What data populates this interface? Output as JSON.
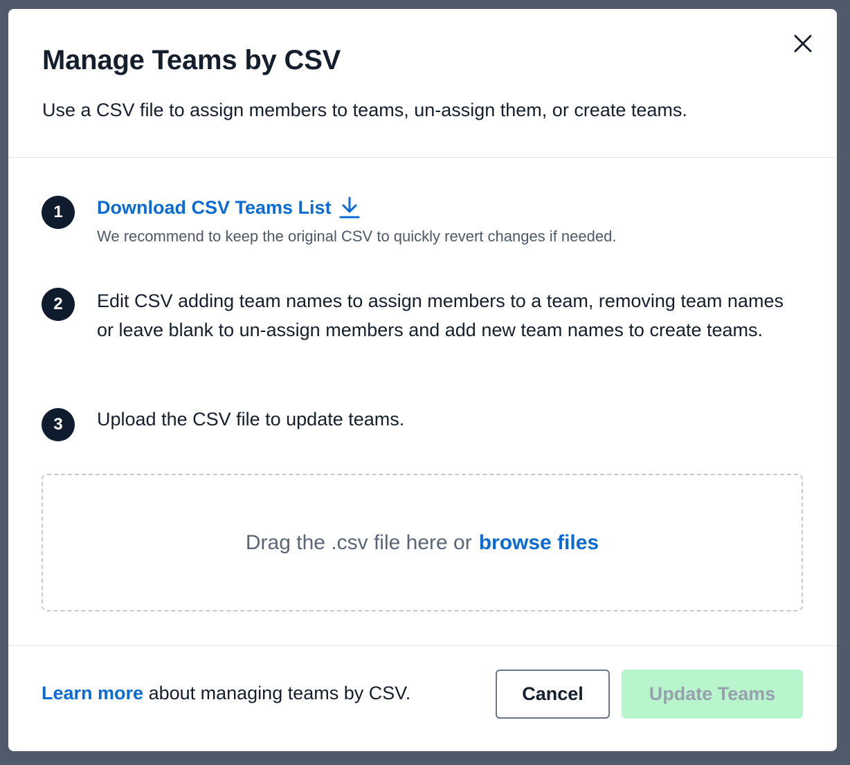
{
  "modal": {
    "title": "Manage Teams by CSV",
    "subtitle": "Use a CSV file to assign members to teams, un-assign them, or create teams.",
    "close_icon": "close-icon"
  },
  "steps": [
    {
      "number": "1",
      "link_label": "Download CSV Teams List",
      "link_icon": "download-icon",
      "hint": "We recommend to keep the original CSV to quickly revert changes if needed."
    },
    {
      "number": "2",
      "text": "Edit CSV adding team names to assign members to a team, removing team names or leave blank to un-assign members and add new team names to create teams."
    },
    {
      "number": "3",
      "text": "Upload the CSV file to update teams."
    }
  ],
  "dropzone": {
    "text": "Drag the .csv file here or",
    "link_label": "browse files"
  },
  "footer": {
    "learn_link": "Learn more",
    "learn_text": " about managing teams by CSV.",
    "cancel_label": "Cancel",
    "update_label": "Update Teams"
  },
  "colors": {
    "accent": "#0a6bd4",
    "primary_disabled_bg": "#b8f5cc",
    "step_badge": "#0f1c2d"
  }
}
